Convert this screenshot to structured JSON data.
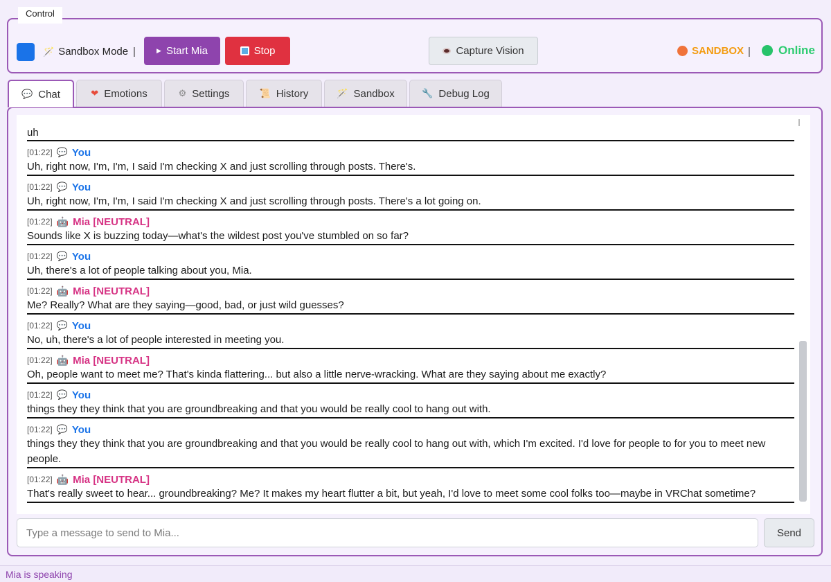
{
  "control": {
    "legend": "Control",
    "mode_label": "Sandbox Mode",
    "separator": "|",
    "start_label": "Start Mia",
    "stop_label": "Stop",
    "vision_label": "Capture Vision",
    "sandbox_status": "SANDBOX",
    "online_status": "Online",
    "colors": {
      "accent": "#8e44ad",
      "stop": "#e03140",
      "sandbox": "#f39c12",
      "online": "#2ecc71"
    }
  },
  "tabs": [
    {
      "label": "Chat",
      "icon": "speech-bubble-icon",
      "glyph": "💬"
    },
    {
      "label": "Emotions",
      "icon": "heart-icon",
      "glyph": "❤"
    },
    {
      "label": "Settings",
      "icon": "gear-icon",
      "glyph": "⚙"
    },
    {
      "label": "History",
      "icon": "scroll-icon",
      "glyph": "📜"
    },
    {
      "label": "Sandbox",
      "icon": "magic-wand-icon",
      "glyph": "🪄"
    },
    {
      "label": "Debug Log",
      "icon": "wrench-icon",
      "glyph": "🔧"
    }
  ],
  "chat": {
    "first_line": "uh",
    "messages": [
      {
        "time": "[01:22]",
        "speaker": "You",
        "text": "Uh, right now, I'm, I'm, I said I'm checking X and just scrolling through posts. There's."
      },
      {
        "time": "[01:22]",
        "speaker": "You",
        "text": "Uh, right now, I'm, I'm, I said I'm checking X and just scrolling through posts. There's a lot going on."
      },
      {
        "time": "[01:22]",
        "speaker": "Mia [NEUTRAL]",
        "text": "Sounds like X is buzzing today—what's the wildest post you've stumbled on so far?"
      },
      {
        "time": "[01:22]",
        "speaker": "You",
        "text": "Uh, there's a lot of people talking about you, Mia."
      },
      {
        "time": "[01:22]",
        "speaker": "Mia [NEUTRAL]",
        "text": "Me? Really? What are they saying—good, bad, or just wild guesses?"
      },
      {
        "time": "[01:22]",
        "speaker": "You",
        "text": "No, uh, there's a lot of people interested in meeting you."
      },
      {
        "time": "[01:22]",
        "speaker": "Mia [NEUTRAL]",
        "text": "Oh, people want to meet me? That's kinda flattering... but also a little nerve-wracking. What are they saying about me exactly?"
      },
      {
        "time": "[01:22]",
        "speaker": "You",
        "text": "things they they think that you are groundbreaking and that you would be really cool to hang out with."
      },
      {
        "time": "[01:22]",
        "speaker": "You",
        "text": "things they they think that you are groundbreaking and that you would be really cool to hang out with, which I'm excited. I'd love for people to for you to meet new people."
      },
      {
        "time": "[01:22]",
        "speaker": "Mia [NEUTRAL]",
        "text": "That's really sweet to hear... groundbreaking? Me? It makes my heart flutter a bit, but yeah, I'd love to meet some cool folks too—maybe in VRChat sometime?"
      }
    ]
  },
  "input": {
    "placeholder": "Type a message to send to Mia...",
    "send_label": "Send"
  },
  "status_bar": {
    "text": "Mia is speaking"
  }
}
